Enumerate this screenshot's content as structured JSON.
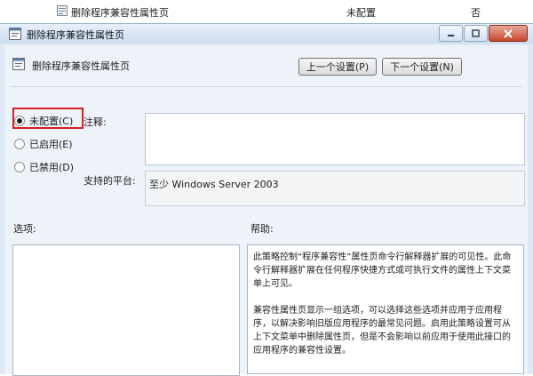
{
  "background_row": {
    "policy_name": "删除程序兼容性属性页",
    "state": "未配置",
    "comment": "否"
  },
  "dialog": {
    "title": "删除程序兼容性属性页",
    "header_title": "删除程序兼容性属性页",
    "prev_button": "上一个设置(P)",
    "next_button": "下一个设置(N)",
    "radios": [
      {
        "label": "未配置(C)",
        "selected": true
      },
      {
        "label": "已启用(E)",
        "selected": false
      },
      {
        "label": "已禁用(D)",
        "selected": false
      }
    ],
    "comment_label": "注释:",
    "comment_value": "",
    "platform_label": "支持的平台:",
    "platform_value": "至少 Windows Server 2003",
    "options_label": "选项:",
    "help_label": "帮助:",
    "help_paragraphs": [
      "此策略控制“程序兼容性”属性页命令行解释器扩展的可见性。此命令行解释器扩展在任何程序快捷方式或可执行文件的属性上下文菜单上可见。",
      "兼容性属性页显示一组选项，可以选择这些选项并应用于应用程序，以解决影响旧版应用程序的最常见问题。启用此策略设置可从上下文菜单中删除属性页，但是不会影响以前应用于使用此接口的应用程序的兼容性设置。"
    ]
  },
  "colors": {
    "window_bg": "#dfe9f5",
    "highlight": "#d21f1f",
    "close_button": "#c7452b"
  }
}
